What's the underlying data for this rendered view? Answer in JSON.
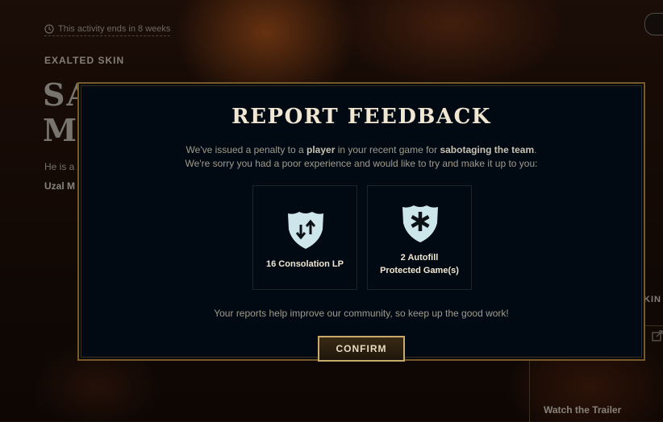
{
  "background": {
    "timer_text": "This activity ends in 8 weeks",
    "skin_tier": "EXALTED SKIN",
    "skin_title": "SA\nMO",
    "skin_desc": "He is a",
    "skin_artist": "Uzal M",
    "right_label": "KIN",
    "watch_trailer": "Watch the Trailer"
  },
  "modal": {
    "title": "REPORT FEEDBACK",
    "message_line1": {
      "a": "We've issued a penalty to a ",
      "b": "player",
      "c": " in your recent game for ",
      "d": "sabotaging the team",
      "e": "."
    },
    "message_line2": "We're sorry you had a poor experience and would like to try and make it up to you:",
    "rewards": [
      {
        "label": "16 Consolation LP",
        "icon": "lp-exchange-shield-icon"
      },
      {
        "label_line1": "2 Autofill",
        "label_line2": "Protected Game(s)",
        "icon": "autofill-asterisk-shield-icon"
      }
    ],
    "footer": "Your reports help improve our community, so keep up the good work!",
    "confirm_label": "CONFIRM"
  },
  "colors": {
    "accent_gold": "#c8aa6e",
    "modal_bg": "#010a13",
    "shield_fill": "#cde6ec",
    "title_text": "#f0e6d2"
  }
}
